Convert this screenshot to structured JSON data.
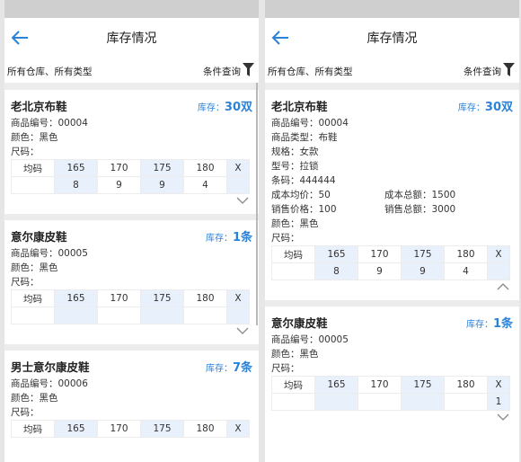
{
  "left": {
    "title": "库存情况",
    "filter": {
      "scope": "所有仓库、所有类型",
      "query_label": "条件查询"
    },
    "cards": [
      {
        "name": "老北京布鞋",
        "stock_label": "库存：",
        "stock_value": "30双",
        "code": "商品编号：00004",
        "color": "颜色：黑色",
        "size_label": "尺码：",
        "sizes": [
          "均码",
          "165",
          "170",
          "175",
          "180",
          "X"
        ],
        "counts": [
          "",
          "8",
          "9",
          "9",
          "4",
          ""
        ]
      },
      {
        "name": "意尔康皮鞋",
        "stock_label": "库存：",
        "stock_value": "1条",
        "code": "商品编号：00005",
        "color": "颜色：黑色",
        "size_label": "尺码：",
        "sizes": [
          "均码",
          "165",
          "170",
          "175",
          "180",
          "X"
        ],
        "counts": [
          "",
          "",
          "",
          "",
          "",
          ""
        ]
      },
      {
        "name": "男士意尔康皮鞋",
        "stock_label": "库存：",
        "stock_value": "7条",
        "code": "商品编号：00006",
        "color": "颜色：黑色",
        "size_label": "尺码：",
        "sizes": [
          "均码",
          "165",
          "170",
          "175",
          "180",
          "X"
        ]
      }
    ]
  },
  "right": {
    "title": "库存情况",
    "filter": {
      "scope": "所有仓库、所有类型",
      "query_label": "条件查询"
    },
    "card1": {
      "name": "老北京布鞋",
      "stock_label": "库存：",
      "stock_value": "30双",
      "code": "商品编号：00004",
      "type": "商品类型：布鞋",
      "spec": "规格：女款",
      "model": "型号：拉锁",
      "barcode": "条码：444444",
      "cost_avg": "成本均价：50",
      "cost_total": "成本总额：1500",
      "sale_price": "销售价格：100",
      "sale_total": "销售总额：3000",
      "color": "颜色：黑色",
      "size_label": "尺码：",
      "sizes": [
        "均码",
        "165",
        "170",
        "175",
        "180",
        "X"
      ],
      "counts": [
        "",
        "8",
        "9",
        "9",
        "4",
        ""
      ]
    },
    "card2": {
      "name": "意尔康皮鞋",
      "stock_label": "库存：",
      "stock_value": "1条",
      "code": "商品编号：00005",
      "color": "颜色：黑色",
      "size_label": "尺码：",
      "sizes": [
        "均码",
        "165",
        "170",
        "175",
        "180",
        "X"
      ],
      "counts": [
        "",
        "",
        "",
        "",
        "",
        "1"
      ]
    }
  }
}
